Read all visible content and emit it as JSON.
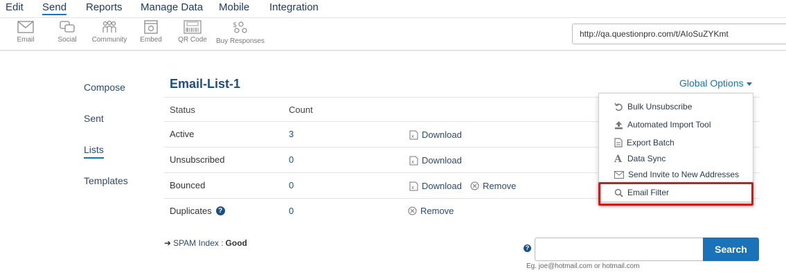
{
  "top_menu": [
    "Edit",
    "Send",
    "Reports",
    "Manage Data",
    "Mobile",
    "Integration"
  ],
  "toolbar": {
    "items": [
      "Email",
      "Social",
      "Community",
      "Embed",
      "QR Code",
      "Buy Responses"
    ],
    "url": "http://qa.questionpro.com/t/AIoSuZYKmt"
  },
  "left_nav": [
    "Compose",
    "Sent",
    "Lists",
    "Templates"
  ],
  "list": {
    "title": "Email-List-1",
    "headers": {
      "status": "Status",
      "count": "Count"
    },
    "rows": [
      {
        "status": "Active",
        "count": "3"
      },
      {
        "status": "Unsubscribed",
        "count": "0"
      },
      {
        "status": "Bounced",
        "count": "0"
      },
      {
        "status": "Duplicates",
        "count": "0"
      }
    ],
    "download_label": "Download",
    "remove_label": "Remove"
  },
  "global_options": {
    "label": "Global Options",
    "items": [
      {
        "label": "Bulk Unsubscribe",
        "icon": "undo-icon"
      },
      {
        "label": "Automated Import Tool",
        "icon": "upload-icon"
      },
      {
        "label": "Export Batch",
        "icon": "document-icon"
      },
      {
        "label": "Data Sync",
        "icon": "font-icon"
      },
      {
        "label": "Send Invite to New Addresses",
        "icon": "envelope-icon"
      },
      {
        "label": "Email Filter",
        "icon": "search-icon"
      }
    ]
  },
  "spam": {
    "label": "SPAM Index :",
    "value": "Good"
  },
  "search": {
    "placeholder": "",
    "button": "Search",
    "hint": "Eg. joe@hotmail.com or hotmail.com"
  },
  "colors": {
    "accent": "#1a73b8",
    "title": "#1f4f82",
    "highlight": "#d11a1a"
  }
}
